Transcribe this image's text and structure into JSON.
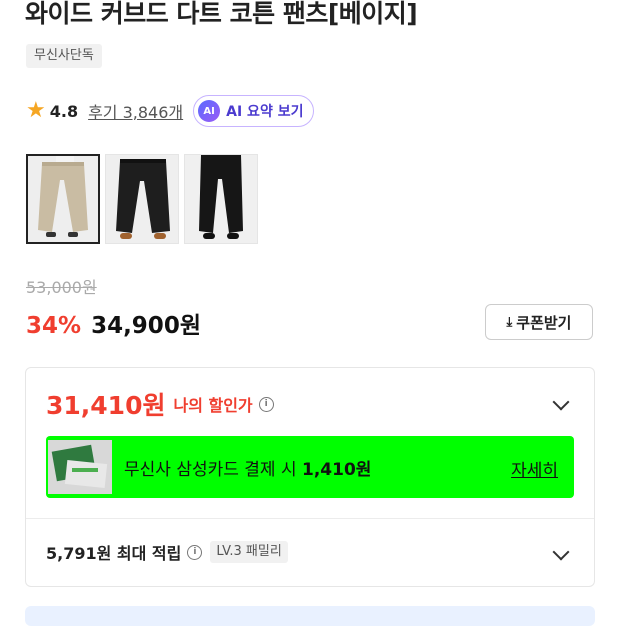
{
  "product": {
    "title": "와이드 커브드 다트 코튼 팬츠[베이지]",
    "tag": "무신사단독"
  },
  "rating": {
    "star_icon": "star-icon",
    "value": "4.8",
    "reviews_label": "후기 3,846개"
  },
  "ai_summary": {
    "badge": "AI",
    "label": "AI 요약 보기"
  },
  "thumbnails": [
    {
      "name": "beige-pants",
      "selected": true
    },
    {
      "name": "black-pants-brown-shoes",
      "selected": false
    },
    {
      "name": "black-pants-black-shoes",
      "selected": false
    }
  ],
  "pricing": {
    "original": "53,000원",
    "discount": "34%",
    "sale": "34,900원",
    "coupon_label": "쿠폰받기"
  },
  "my_price": {
    "amount": "31,410원",
    "label": "나의 할인가",
    "info_glyph": "i"
  },
  "promo": {
    "text_prefix": "무신사 삼성카드 결제 시 ",
    "text_amount": "1,410원",
    "detail_link": "자세히",
    "bg_color": "#00ff00"
  },
  "points": {
    "text": "5,791원 최대 적립",
    "info_glyph": "i",
    "level": "LV.3 패밀리"
  },
  "colors": {
    "accent_red": "#f03e2f",
    "ai_purple": "#4b3bcf",
    "star": "#f5a623"
  }
}
